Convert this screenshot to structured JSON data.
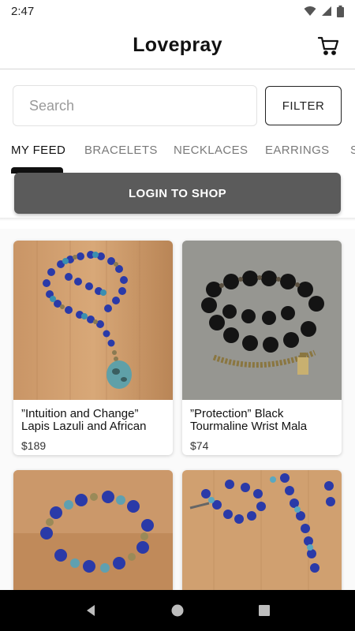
{
  "status_bar": {
    "time": "2:47"
  },
  "header": {
    "title": "Lovepray"
  },
  "search": {
    "placeholder": "Search",
    "value": ""
  },
  "filter": {
    "label": "FILTER"
  },
  "tabs": [
    {
      "label": "MY FEED",
      "active": true
    },
    {
      "label": "BRACELETS",
      "active": false
    },
    {
      "label": "NECKLACES",
      "active": false
    },
    {
      "label": "EARRINGS",
      "active": false
    },
    {
      "label": "S",
      "active": false
    }
  ],
  "login": {
    "label": "LOGIN TO SHOP"
  },
  "products": [
    {
      "title_line1": "”Intuition and Change”",
      "title_line2": "Lapis Lazuli and African",
      "price": "$189",
      "image": "lapis-necklace-on-wood"
    },
    {
      "title_line1": "”Protection” Black",
      "title_line2": "Tourmaline Wrist Mala",
      "price": "$74",
      "image": "black-tourmaline-bracelet-on-stone"
    },
    {
      "title_line1": "",
      "title_line2": "",
      "price": "",
      "image": "lapis-bracelet-stack-on-wood"
    },
    {
      "title_line1": "",
      "title_line2": "",
      "price": "",
      "image": "lapis-mala-on-wood"
    }
  ],
  "colors": {
    "accent": "#111111",
    "login_bg": "#5b5b5b",
    "tab_inactive": "#7a7a7a"
  },
  "icons": [
    "wifi-icon",
    "signal-icon",
    "battery-icon",
    "cart-icon",
    "back-icon",
    "home-icon",
    "recents-icon"
  ]
}
